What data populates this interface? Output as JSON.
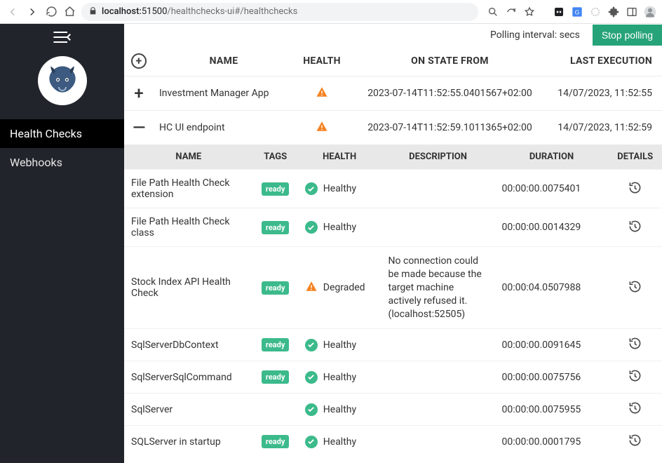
{
  "browser": {
    "url_host": "localhost:",
    "url_port": "51500",
    "url_path": "/healthchecks-ui#/healthchecks"
  },
  "topbar": {
    "polling_label": "Polling interval: secs",
    "stop_label": "Stop polling"
  },
  "sidebar": {
    "items": [
      {
        "label": "Health Checks",
        "active": true
      },
      {
        "label": "Webhooks",
        "active": false
      }
    ]
  },
  "groups_header": {
    "name": "NAME",
    "health": "HEALTH",
    "on_state": "ON STATE FROM",
    "last_exec": "LAST EXECUTION"
  },
  "groups": [
    {
      "expand": "+",
      "name": "Investment Manager App",
      "status": "warn",
      "on_state": "2023-07-14T11:52:55.0401567+02:00",
      "last_exec": "14/07/2023, 11:52:55"
    },
    {
      "expand": "—",
      "name": "HC UI endpoint",
      "status": "warn",
      "on_state": "2023-07-14T11:52:59.1011365+02:00",
      "last_exec": "14/07/2023, 11:52:59"
    }
  ],
  "detail_header": {
    "name": "NAME",
    "tags": "TAGS",
    "health": "HEALTH",
    "description": "DESCRIPTION",
    "duration": "DURATION",
    "details": "DETAILS"
  },
  "details": [
    {
      "name": "File Path Health Check extension",
      "tag": "ready",
      "status": "ok",
      "status_label": "Healthy",
      "desc": "",
      "duration": "00:00:00.0075401"
    },
    {
      "name": "File Path Health Check class",
      "tag": "ready",
      "status": "ok",
      "status_label": "Healthy",
      "desc": "",
      "duration": "00:00:00.0014329"
    },
    {
      "name": "Stock Index API Health Check",
      "tag": "ready",
      "status": "warn",
      "status_label": "Degraded",
      "desc": "No connection could be made because the target machine actively refused it. (localhost:52505)",
      "duration": "00:00:04.0507988"
    },
    {
      "name": "SqlServerDbContext",
      "tag": "ready",
      "status": "ok",
      "status_label": "Healthy",
      "desc": "",
      "duration": "00:00:00.0091645"
    },
    {
      "name": "SqlServerSqlCommand",
      "tag": "ready",
      "status": "ok",
      "status_label": "Healthy",
      "desc": "",
      "duration": "00:00:00.0075756"
    },
    {
      "name": "SqlServer",
      "tag": "",
      "status": "ok",
      "status_label": "Healthy",
      "desc": "",
      "duration": "00:00:00.0075955"
    },
    {
      "name": "SQLServer in startup",
      "tag": "ready",
      "status": "ok",
      "status_label": "Healthy",
      "desc": "",
      "duration": "00:00:00.0001795"
    }
  ]
}
